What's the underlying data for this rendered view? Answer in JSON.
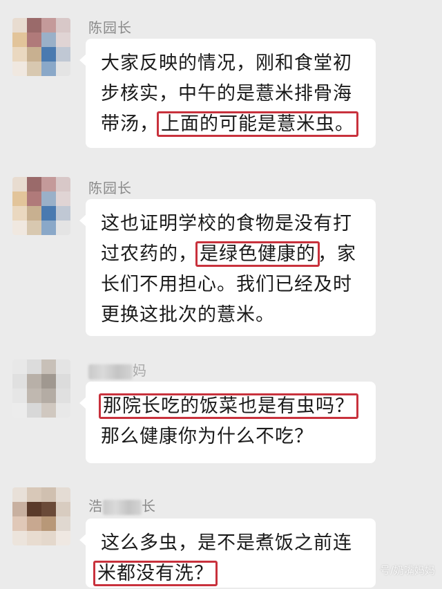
{
  "messages": [
    {
      "sender": "陈园长",
      "lines": [
        [
          "大家反映的情况，刚和食堂初"
        ],
        [
          "步核实，中午的是薏米排骨海"
        ],
        [
          "带汤，",
          {
            "hl": "上面的可能是薏米虫。"
          }
        ]
      ]
    },
    {
      "sender": "陈园长",
      "lines": [
        [
          "这也证明学校的食物是没有打"
        ],
        [
          "过农药的，",
          {
            "hl": "是绿色健康的"
          },
          "，家"
        ],
        [
          "长们不用担心。我们已经及时"
        ],
        [
          "更换这批次的薏米。"
        ]
      ]
    },
    {
      "sender_visible": "妈",
      "lines": [
        [
          {
            "hl": "那院长吃的饭菜也是有虫吗？"
          }
        ],
        [
          "那么健康你为什么不吃？"
        ]
      ]
    },
    {
      "sender_prefix": "浩",
      "sender_suffix": "长",
      "lines": [
        [
          "这么多虫，是不是煮饭之前连"
        ],
        [
          {
            "hl": "米都没有洗？"
          }
        ]
      ]
    }
  ],
  "watermark": "号/奶嘴妈妈",
  "colors": {
    "background": "#ebebeb",
    "bubble": "#ffffff",
    "highlight_border": "#c8313c"
  }
}
